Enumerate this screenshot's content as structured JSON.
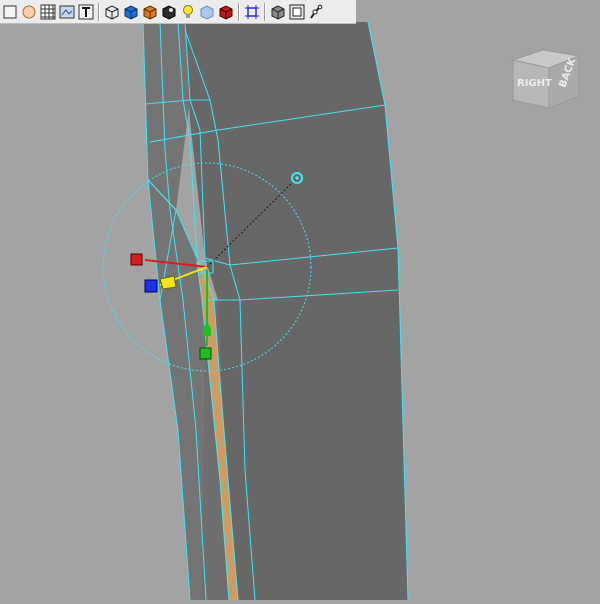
{
  "viewport": {
    "background": "#a3a3a3",
    "mesh_color": "#6a6a6a",
    "wire_color": "#41e5f3",
    "selected_edge_color": "#f4a14a"
  },
  "toolbar": {
    "items": [
      {
        "icon": "select-box-icon",
        "type": "button"
      },
      {
        "icon": "wireframe-sphere-icon",
        "type": "button"
      },
      {
        "icon": "grid-shaded-icon",
        "type": "button"
      },
      {
        "icon": "texture-view-icon",
        "type": "button"
      },
      {
        "icon": "text-tool-icon",
        "type": "button"
      },
      {
        "type": "separator"
      },
      {
        "icon": "wireframe-cube-icon",
        "type": "button"
      },
      {
        "icon": "smooth-shade-cube-icon",
        "type": "button"
      },
      {
        "icon": "textured-cube-icon",
        "type": "button"
      },
      {
        "icon": "lighting-icon",
        "type": "button"
      },
      {
        "icon": "light-bulb-icon",
        "type": "button"
      },
      {
        "icon": "xray-cube-icon",
        "type": "button"
      },
      {
        "icon": "backface-cube-icon",
        "type": "button"
      },
      {
        "type": "separator"
      },
      {
        "icon": "isolate-select-icon",
        "type": "button"
      },
      {
        "type": "separator"
      },
      {
        "icon": "xray-joints-icon",
        "type": "button"
      },
      {
        "icon": "resolution-gate-icon",
        "type": "button"
      },
      {
        "icon": "joint-tool-icon",
        "type": "button"
      }
    ]
  },
  "view_cube": {
    "front_label": "RIGHT",
    "side_label": "BACK"
  },
  "manipulator": {
    "x_axis_color": "#d81e1e",
    "y_axis_color": "#1fbf1f",
    "z_axis_color": "#1e2ee6",
    "center_color": "#f1e61a"
  }
}
